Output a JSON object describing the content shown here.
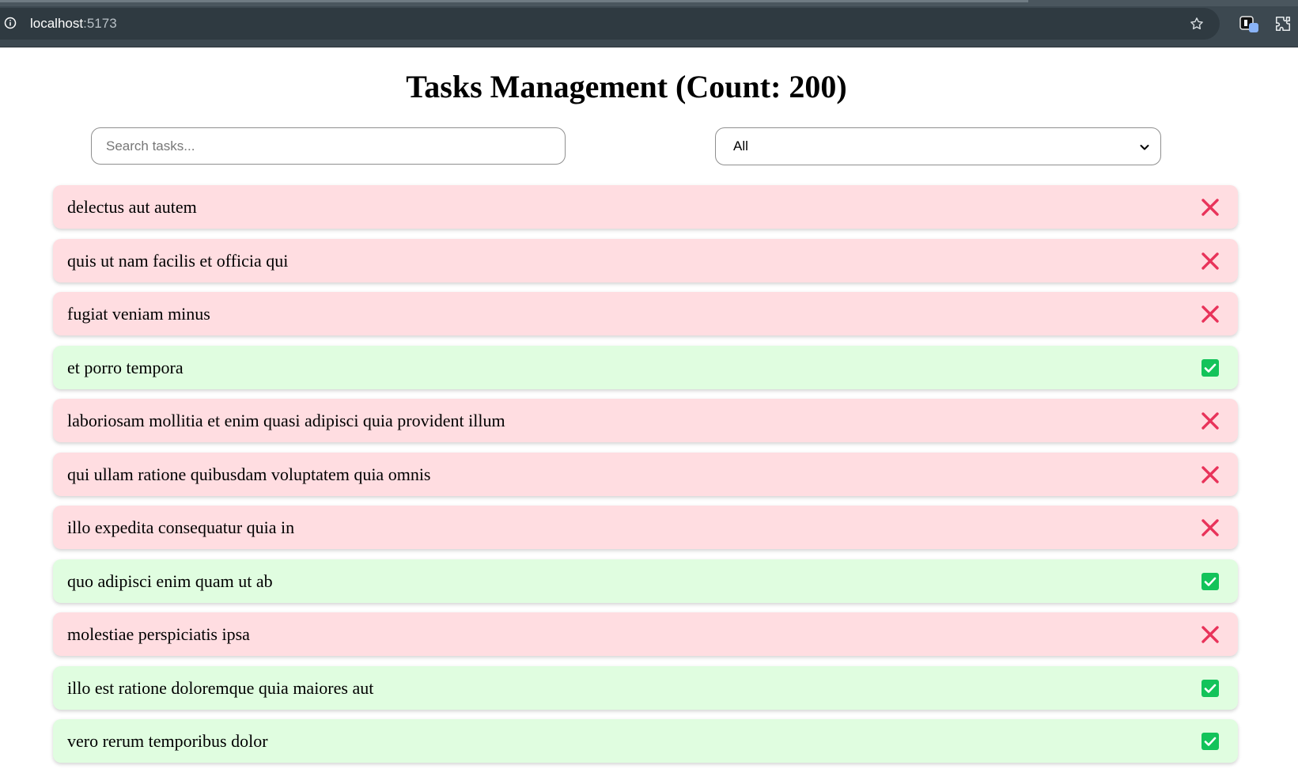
{
  "browser": {
    "url_host": "localhost",
    "url_port": ":5173",
    "icons": [
      "info-icon",
      "bookmark-star-icon",
      "extension-icon",
      "puzzle-extensions-icon"
    ]
  },
  "page": {
    "title": "Tasks Management (Count: 200)"
  },
  "search": {
    "placeholder": "Search tasks...",
    "value": ""
  },
  "filter": {
    "selected": "All"
  },
  "colors": {
    "completed_bg": "#e0fde0",
    "pending_bg": "#ffdde1",
    "check_green": "#13c35a",
    "cross_red": "#e8335a"
  },
  "tasks": [
    {
      "title": "delectus aut autem",
      "completed": false
    },
    {
      "title": "quis ut nam facilis et officia qui",
      "completed": false
    },
    {
      "title": "fugiat veniam minus",
      "completed": false
    },
    {
      "title": "et porro tempora",
      "completed": true
    },
    {
      "title": "laboriosam mollitia et enim quasi adipisci quia provident illum",
      "completed": false
    },
    {
      "title": "qui ullam ratione quibusdam voluptatem quia omnis",
      "completed": false
    },
    {
      "title": "illo expedita consequatur quia in",
      "completed": false
    },
    {
      "title": "quo adipisci enim quam ut ab",
      "completed": true
    },
    {
      "title": "molestiae perspiciatis ipsa",
      "completed": false
    },
    {
      "title": "illo est ratione doloremque quia maiores aut",
      "completed": true
    },
    {
      "title": "vero rerum temporibus dolor",
      "completed": true
    }
  ]
}
